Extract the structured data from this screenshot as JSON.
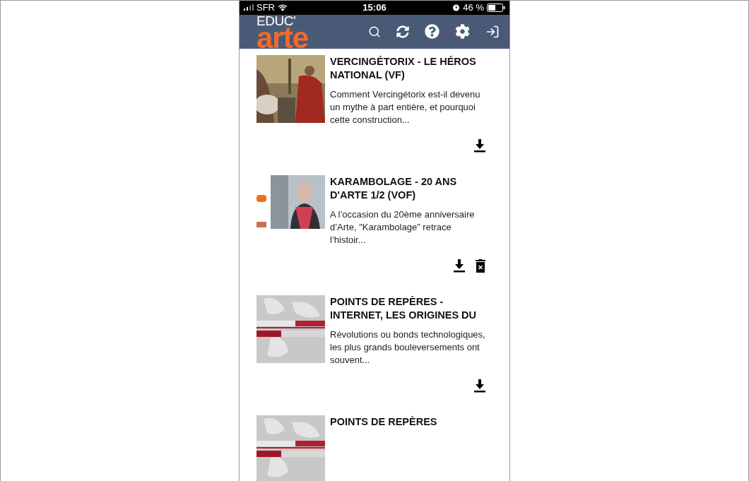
{
  "status_bar": {
    "carrier": "SFR",
    "time": "15:06",
    "battery": "46 %"
  },
  "header": {
    "logo_top": "EDUC'",
    "logo_main": "arte"
  },
  "items": [
    {
      "title": "VERCINGÉTORIX - LE HÉROS NATIONAL (VF)",
      "description": "Comment Vercingétorix est-il devenu un mythe à part entière, et pourquoi cette construction...",
      "downloaded": false
    },
    {
      "title": "KARAMBOLAGE - 20 ANS D'ARTE 1/2 (VOF)",
      "description": "A l’occasion du 20ème anniversaire d’Arte, \"Karambolage\" retrace l’histoir...",
      "downloaded": true
    },
    {
      "title": "POINTS DE REPÈRES - INTERNET, LES ORIGINES DU",
      "description": "Révolutions ou bonds technologiques, les plus grands bouleversements ont souvent...",
      "downloaded": false
    },
    {
      "title": "POINTS DE REPÈRES"
    }
  ]
}
